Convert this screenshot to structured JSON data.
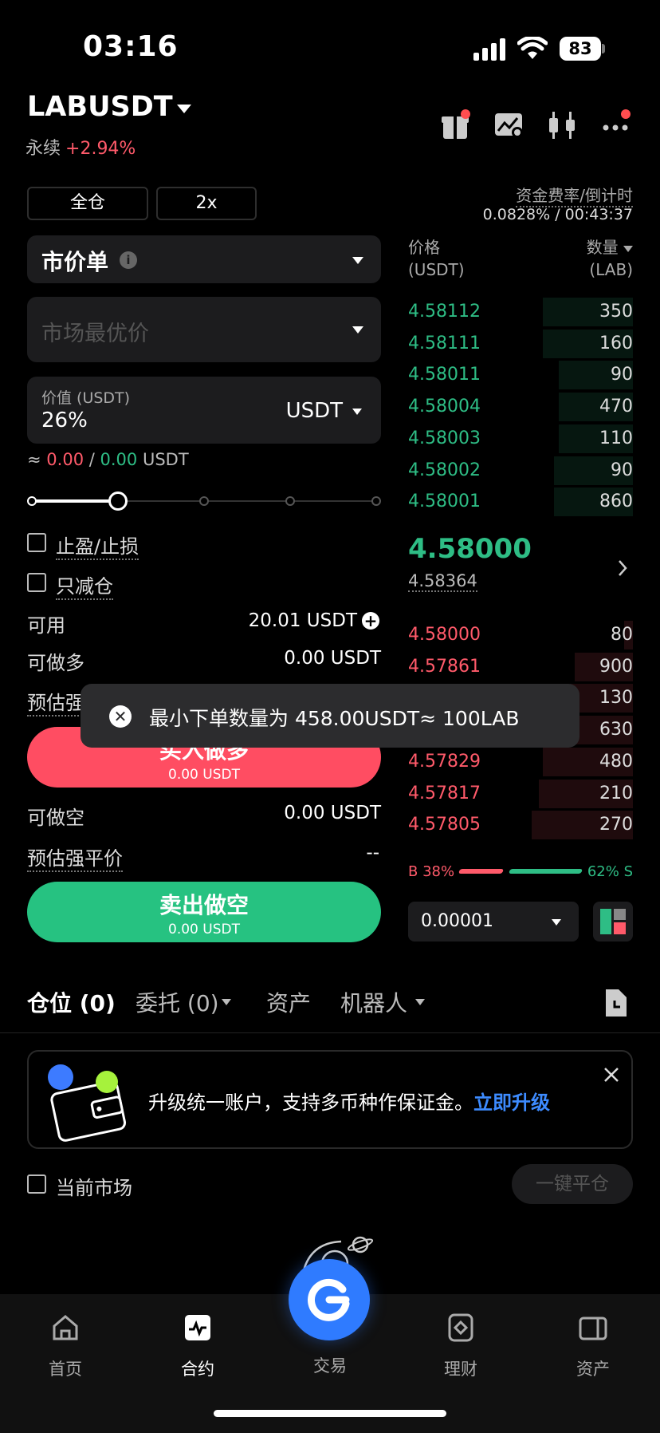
{
  "status_bar": {
    "time": "03:16",
    "battery": "83"
  },
  "header": {
    "pair": "LABUSDT",
    "contract_type": "永续",
    "change": "+2.94%"
  },
  "controls": {
    "margin_mode": "全仓",
    "leverage": "2x",
    "funding_label": "资金费率/倒计时",
    "funding_value": "0.0828% / 00:43:37"
  },
  "order_form": {
    "order_type": "市价单",
    "price_placeholder": "市场最优价",
    "value_label": "价值 (USDT)",
    "value": "26%",
    "unit": "USDT",
    "approx_prefix": "≈",
    "approx_long": "0.00",
    "approx_sep": "/",
    "approx_short": "0.00",
    "approx_unit": "USDT",
    "slider_percent": 25,
    "tp_sl": "止盈/止损",
    "reduce_only": "只减仓",
    "available_label": "可用",
    "available_value": "20.01 USDT",
    "can_long_label": "可做多",
    "can_long_value": "0.00 USDT",
    "est_liq_label": "预估强平价",
    "buy_label": "买入做多",
    "buy_sub": "0.00 USDT",
    "can_short_label": "可做空",
    "can_short_value": "0.00 USDT",
    "est_liq_label2": "预估强平价",
    "est_liq_value2": "--",
    "sell_label": "卖出做空",
    "sell_sub": "0.00 USDT"
  },
  "orderbook": {
    "price_header": "价格",
    "price_unit": "(USDT)",
    "qty_header": "数量",
    "qty_unit": "(LAB)",
    "bids": [
      {
        "price": "4.58112",
        "qty": "350",
        "depth": 0.4
      },
      {
        "price": "4.58111",
        "qty": "160",
        "depth": 0.4
      },
      {
        "price": "4.58011",
        "qty": "90",
        "depth": 0.33
      },
      {
        "price": "4.58004",
        "qty": "470",
        "depth": 0.33
      },
      {
        "price": "4.58003",
        "qty": "110",
        "depth": 0.33
      },
      {
        "price": "4.58002",
        "qty": "90",
        "depth": 0.35
      },
      {
        "price": "4.58001",
        "qty": "860",
        "depth": 0.35
      }
    ],
    "last_price": "4.58000",
    "mark_price": "4.58364",
    "asks": [
      {
        "price": "4.58000",
        "qty": "80",
        "depth": 0.04
      },
      {
        "price": "4.57861",
        "qty": "900",
        "depth": 0.26
      },
      {
        "price": "",
        "qty": "130",
        "depth": 0.28
      },
      {
        "price": "",
        "qty": "630",
        "depth": 0.29
      },
      {
        "price": "4.57829",
        "qty": "480",
        "depth": 0.4
      },
      {
        "price": "4.57817",
        "qty": "210",
        "depth": 0.42
      },
      {
        "price": "4.57805",
        "qty": "270",
        "depth": 0.45
      }
    ],
    "buy_ratio": "B 38%",
    "sell_ratio": "62% S",
    "buy_ratio_value": 0.38,
    "precision": "0.00001"
  },
  "toast": {
    "message": "最小下单数量为 458.00USDT≈ 100LAB"
  },
  "tabs": [
    {
      "label": "仓位 (0)"
    },
    {
      "label": "委托 (0)"
    },
    {
      "label": "资产"
    },
    {
      "label": "机器人"
    }
  ],
  "banner": {
    "text": "升级统一账户，支持多币种作保证金。",
    "link": "立即升级"
  },
  "bottom_controls": {
    "current_market": "当前市场",
    "close_all": "一键平仓"
  },
  "nav": [
    {
      "label": "首页"
    },
    {
      "label": "合约"
    },
    {
      "label": "交易"
    },
    {
      "label": "理财"
    },
    {
      "label": "资产"
    }
  ],
  "colors": {
    "green": "#2ebd85",
    "red": "#ff5a6a",
    "link": "#3d8bff",
    "fab": "#2f7bff"
  }
}
